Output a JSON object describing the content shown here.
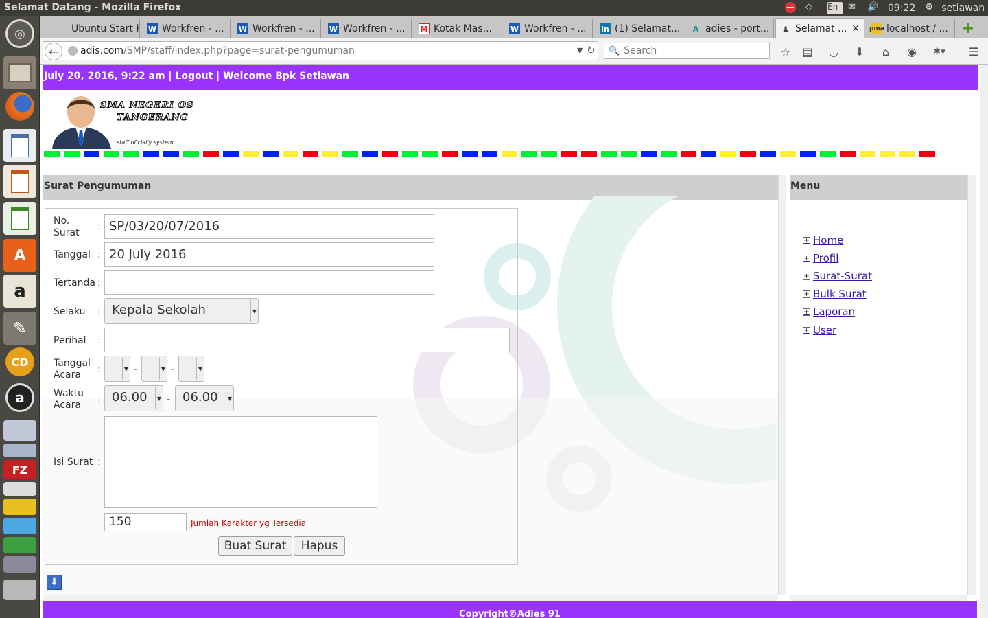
{
  "system": {
    "window_title": "Selamat Datang - Mozilla Firefox",
    "keyboard": "En",
    "time": "09:22",
    "user": "setiawan"
  },
  "launcher": {
    "items": [
      "ubuntu-icon",
      "files-icon",
      "firefox-icon",
      "writer-icon",
      "impress-icon",
      "calc-icon",
      "software-center-icon",
      "amazon-icon",
      "settings-icon",
      "cd-icon",
      "audacious-icon",
      "vlc-icon",
      "app-icon",
      "filezilla-icon",
      "printer-icon",
      "app-icon",
      "app-icon",
      "app-icon",
      "app-icon"
    ]
  },
  "tabs": [
    {
      "label": "Ubuntu Start P...",
      "icon": "ubuntu-icon"
    },
    {
      "label": "Workfren - ...",
      "icon": "w-icon"
    },
    {
      "label": "Workfren - ...",
      "icon": "w-icon"
    },
    {
      "label": "Workfren - ...",
      "icon": "w-icon"
    },
    {
      "label": "Kotak Mas...",
      "icon": "gmail-icon"
    },
    {
      "label": "Workfren - ...",
      "icon": "w-icon"
    },
    {
      "label": "(1) Selamat...",
      "icon": "linkedin-icon"
    },
    {
      "label": "adies - port...",
      "icon": "a-icon"
    },
    {
      "label": "Selamat ...",
      "icon": "user-icon",
      "active": true
    },
    {
      "label": "localhost / ...",
      "icon": "pma-icon"
    }
  ],
  "nav": {
    "url_domain": "adis.com",
    "url_path": "/SMP/staff/index.php?page=surat-pengumuman",
    "search_placeholder": "Search"
  },
  "page": {
    "header": {
      "date": "July 20, 2016, 9:22 am",
      "sep1": "|",
      "logout": "Logout",
      "sep2": "|",
      "welcome": "Welcome Bpk Setiawan"
    },
    "logo": {
      "line1": "SMA NEGERI OS",
      "line2": "TANGERANG",
      "tagline": "staff oficially system"
    },
    "stripe_colors": [
      "#00ee33",
      "#00ee33",
      "#0022ee",
      "#00ee33",
      "#00ee33",
      "#0022ee",
      "#0022ee",
      "#00ee33",
      "#ee0011",
      "#0022ee",
      "#ffee33",
      "#0022ee",
      "#ffee33",
      "#ee0011",
      "#ffee33",
      "#00ee33",
      "#0022ee",
      "#ee0011",
      "#00ee33",
      "#00ee33",
      "#ee0011",
      "#0022ee",
      "#0022ee",
      "#ffee33",
      "#00ee33",
      "#00ee33",
      "#ee0011",
      "#ee0011",
      "#00ee33",
      "#00ee33",
      "#0022ee",
      "#00ee33",
      "#ee0011",
      "#0022ee",
      "#ffee33",
      "#ee0011",
      "#0022ee",
      "#ffee33",
      "#0022ee",
      "#00ee33",
      "#ee0011",
      "#ffee33",
      "#ffee33",
      "#ffee33",
      "#ee0011"
    ],
    "form_title": "Surat Pengumuman",
    "form": {
      "no_surat_label": "No. Surat",
      "no_surat_value": "SP/03/20/07/2016",
      "tanggal_label": "Tanggal",
      "tanggal_value": "20 July 2016",
      "tertanda_label": "Tertanda",
      "tertanda_value": "",
      "selaku_label": "Selaku",
      "selaku_value": "Kepala Sekolah",
      "perihal_label": "Perihal",
      "perihal_value": "",
      "tanggal_acara_label": "Tanggal Acara",
      "date_sep": "-",
      "waktu_acara_label": "Waktu Acara",
      "waktu_start": "06.00",
      "waktu_end": "06.00",
      "isi_surat_label": "Isi Surat",
      "isi_surat_value": "",
      "char_count": "150",
      "char_note": "Jumlah Karakter yg Tersedia",
      "colon": ":",
      "submit": "Buat Surat",
      "reset": "Hapus"
    },
    "menu_title": "Menu",
    "menu": [
      "Home",
      "Profil",
      "Surat-Surat",
      "Bulk Surat",
      "Laporan",
      "User"
    ],
    "footer": "Copyright©Adies 91"
  },
  "colors": {
    "accent": "#9933ff",
    "panel_header": "#cfcfcf",
    "note": "#cc0000"
  }
}
